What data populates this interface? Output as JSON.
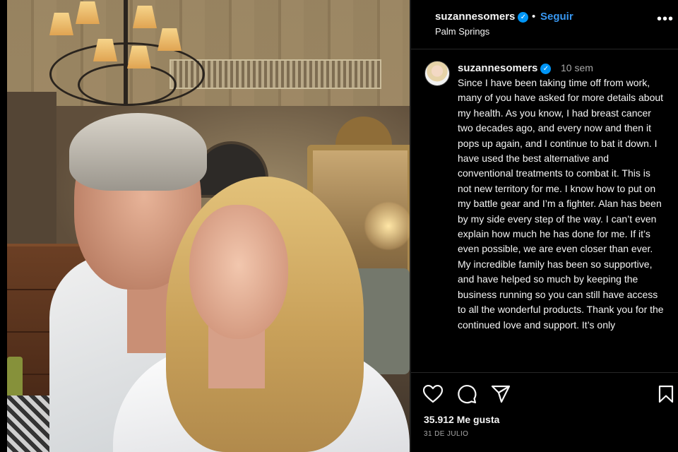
{
  "post": {
    "username": "suzannesomers",
    "follow_separator": "•",
    "follow_label": "Seguir",
    "location": "Palm Springs",
    "more_icon": "more-options-icon"
  },
  "caption": {
    "username": "suzannesomers",
    "time_ago": "10 sem",
    "text": "Since I have been taking time off from work, many of you have asked for more details about my health. As you know, I had breast cancer two decades ago, and every now and then it pops up again, and I continue to bat it down. I have used the best alternative and conventional treatments to combat it. This is not new territory for me. I know how to put on my battle gear and I’m a fighter. Alan has been by my side every step of the way. I can’t even explain how much he has done for me. If it’s even possible, we are even closer than ever. My incredible family has been so supportive, and have helped so much by keeping the business running so you can still have access to all the wonderful products. Thank you for the continued love and support. It’s only"
  },
  "actions": {
    "icons": [
      "heart-icon",
      "comment-icon",
      "share-icon",
      "bookmark-icon"
    ],
    "likes": "35.912 Me gusta",
    "date": "31 DE JULIO"
  },
  "colors": {
    "background": "#000000",
    "text": "#f5f5f5",
    "secondary_text": "#a8a8a8",
    "follow_blue": "#3897f0",
    "verified_blue": "#0095f6"
  }
}
